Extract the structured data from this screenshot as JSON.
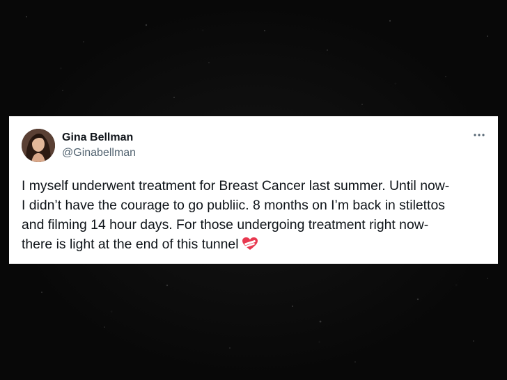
{
  "tweet": {
    "author": {
      "display_name": "Gina Bellman",
      "handle": "@Ginabellman"
    },
    "menu_icon": "more-horizontal-icon",
    "lines": [
      "I myself underwent treatment for Breast Cancer last summer. Until now-",
      "I didn’t have the courage to go publiic. 8 months on I’m back in stilettos",
      "and filming 14 hour days. For those undergoing treatment right now-",
      "there is light at the end of this tunnel"
    ],
    "emoji": "mending-heart-icon"
  },
  "colors": {
    "background": "#0b0b0b",
    "card": "#ffffff",
    "text": "#0f1419",
    "secondary_text": "#536471",
    "heart": "#e8384f"
  }
}
